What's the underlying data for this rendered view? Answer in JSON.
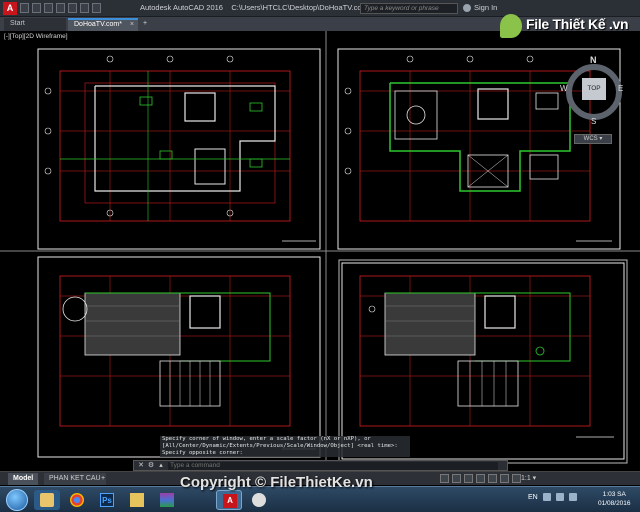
{
  "titlebar": {
    "app_title": "Autodesk AutoCAD 2016",
    "file_path": "C:\\Users\\HTCLC\\Desktop\\DoHoaTV.com.dwg",
    "search_placeholder": "Type a keyword or phrase",
    "sign_in": "Sign In"
  },
  "tabs": {
    "start": "Start",
    "drawing": "DoHoaTV.com*",
    "close": "×",
    "add": "+"
  },
  "viewport": {
    "label": "[-][Top][2D Wireframe]"
  },
  "viewcube": {
    "top": "TOP",
    "n": "N",
    "s": "S",
    "e": "E",
    "w": "W",
    "wcs": "WCS ▾"
  },
  "watermark": {
    "logo_text": "File Thiết Kế .vn",
    "copyright": "Copyright © FileThietKe.vn"
  },
  "command": {
    "history": [
      "Specify corner of window, enter a scale factor (nX or nXP), or",
      "[All/Center/Dynamic/Extents/Previous/Scale/Window/Object] <real time>:",
      "Specify opposite corner:"
    ],
    "placeholder": "Type a command"
  },
  "layout_tabs": {
    "model": "Model",
    "layout": "PHAN KET CAU",
    "add": "+"
  },
  "statusbar": {
    "scale": "1:1 ▾"
  },
  "taskbar": {
    "apps": [
      "explorer-icon",
      "chrome-icon",
      "photoshop-icon",
      "folder-icon",
      "winrar-icon",
      "autocad-icon",
      "paint-icon"
    ],
    "lang": "EN",
    "time": "1:03 SA",
    "date": "01/08/2016"
  },
  "colors": {
    "background": "#000000",
    "frame_red": "#d81e1e",
    "wall_green": "#2ec82e",
    "line_white": "#e8e8e8",
    "accent_blue": "#3c8fd8",
    "autocad_red": "#c8141b"
  }
}
